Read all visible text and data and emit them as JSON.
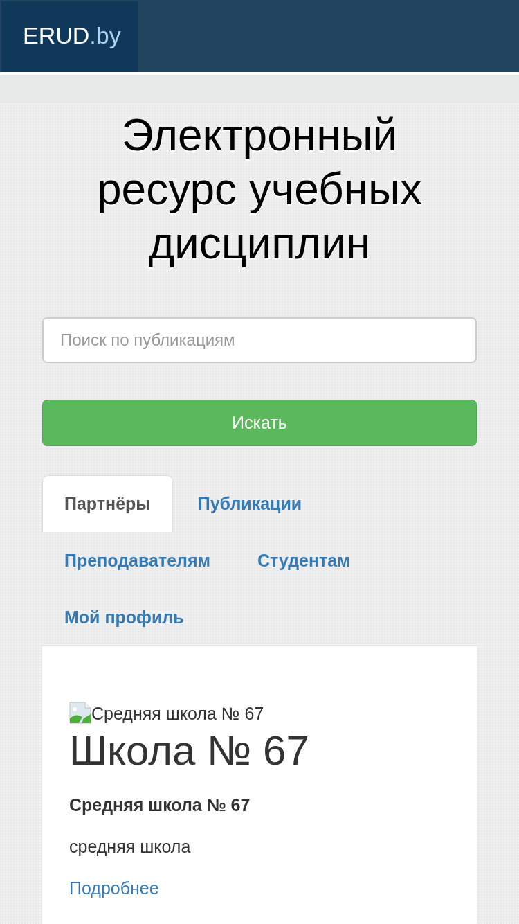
{
  "header": {
    "logo": {
      "main": "ERUD",
      "suffix": ".by"
    }
  },
  "hero": {
    "title": "Электронный ресурс учебных дисциплин"
  },
  "search": {
    "placeholder": "Поиск по публикациям",
    "button": "Искать"
  },
  "tabs": [
    {
      "label": "Партнёры",
      "selected": true
    },
    {
      "label": "Публикации",
      "selected": false
    },
    {
      "label": "Преподавателям",
      "selected": false
    },
    {
      "label": "Студентам",
      "selected": false
    },
    {
      "label": "Мой профиль",
      "selected": false
    }
  ],
  "partner": {
    "image_alt": "Средняя школа № 67",
    "title": "Школа № 67",
    "name": "Средняя школа № 67",
    "type": "средняя школа",
    "link": "Подробнее"
  }
}
